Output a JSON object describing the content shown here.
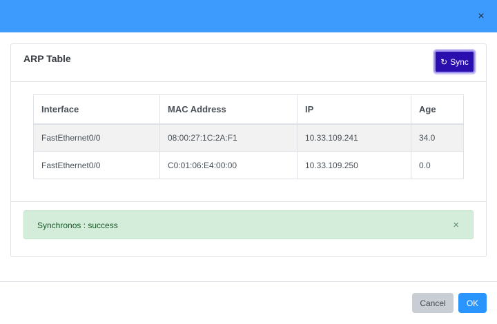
{
  "dialog": {
    "close_symbol": "×"
  },
  "card": {
    "title": "ARP Table",
    "sync_label": "Sync",
    "sync_icon": "↻"
  },
  "table": {
    "headers": [
      "Interface",
      "MAC Address",
      "IP",
      "Age"
    ],
    "rows": [
      [
        "FastEthernet0/0",
        "08:00:27:1C:2A:F1",
        "10.33.109.241",
        "34.0"
      ],
      [
        "FastEthernet0/0",
        "C0:01:06:E4:00:00",
        "10.33.109.250",
        "0.0"
      ]
    ]
  },
  "alert": {
    "message": "Synchronos : success",
    "close_symbol": "×"
  },
  "footer": {
    "cancel_label": "Cancel",
    "ok_label": "OK"
  },
  "colors": {
    "header": "#3d9bfd",
    "sync_button": "#2a0fae",
    "alert_bg": "#d4edda",
    "ok_button": "#2b95ff",
    "cancel_button": "#c9ced5"
  }
}
